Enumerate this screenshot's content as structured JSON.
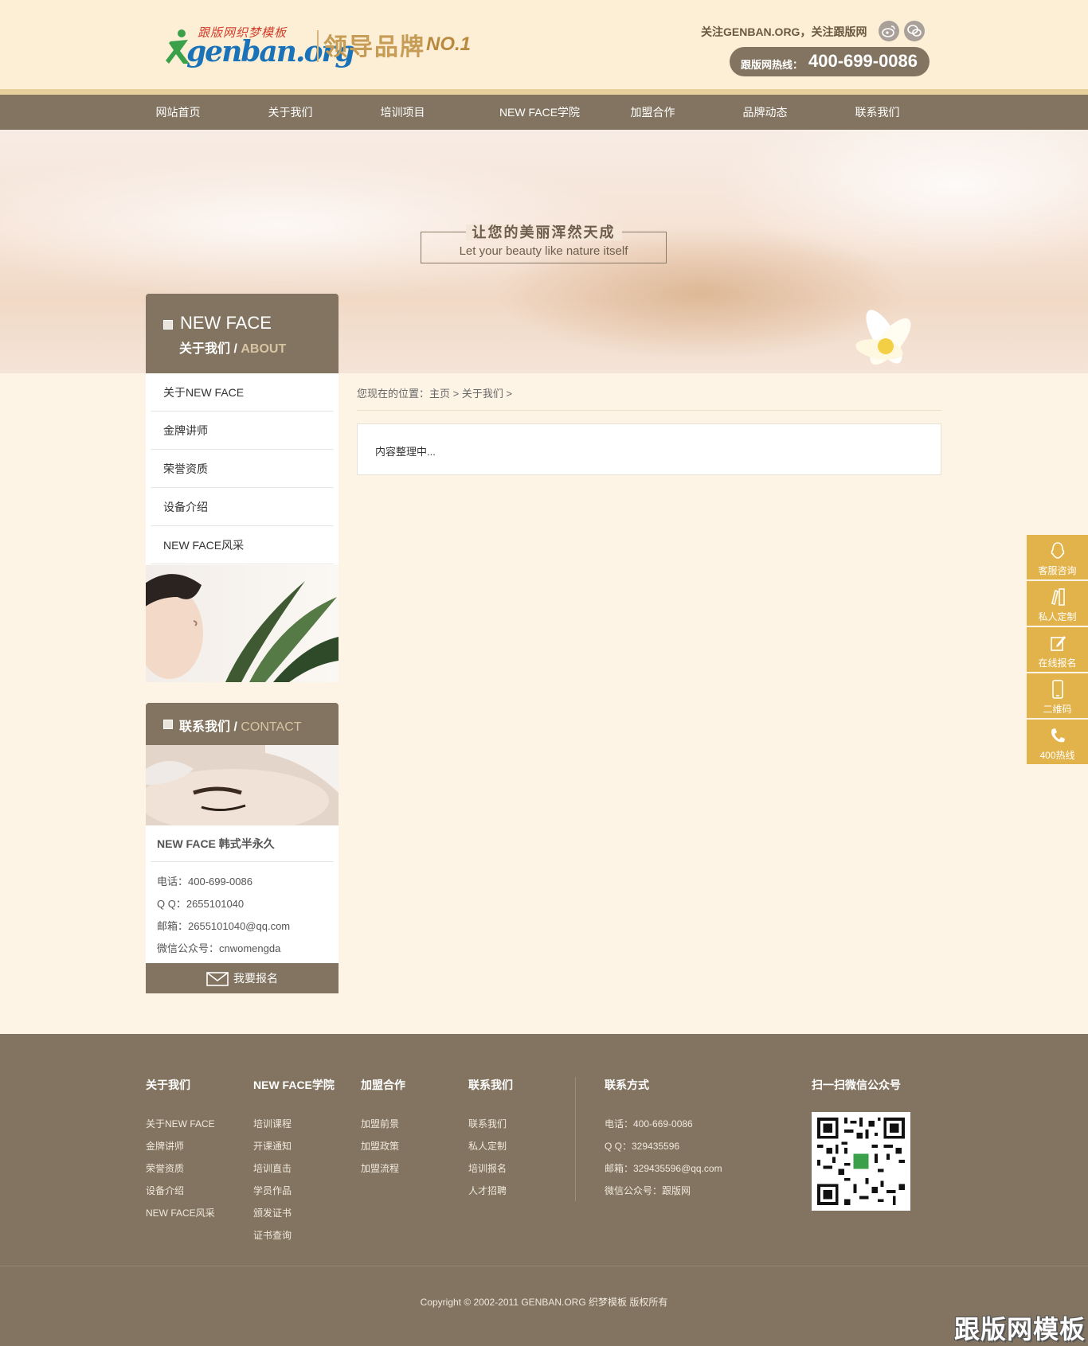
{
  "header": {
    "logo_top": "跟版网织梦模板",
    "logo_main": "genban.org",
    "slogan": "领导品牌",
    "slogan_badge": "NO.1",
    "follow_text": "关注GENBAN.ORG，关注跟版网",
    "social_icons": [
      "weibo-icon",
      "wechat-icon"
    ],
    "hotline_label": "跟版网热线：",
    "hotline_number": "400-699-0086"
  },
  "nav": {
    "items": [
      "网站首页",
      "关于我们",
      "培训项目",
      "NEW FACE学院",
      "加盟合作",
      "品牌动态",
      "联系我们"
    ]
  },
  "banner": {
    "title": "让您的美丽浑然天成",
    "subtitle": "Let your beauty like nature itself"
  },
  "sidebar": {
    "title": "NEW FACE",
    "subtitle_cn": "关于我们",
    "subtitle_sep": "/",
    "subtitle_en": "ABOUT",
    "items": [
      "关于NEW FACE",
      "金牌讲师",
      "荣誉资质",
      "设备介绍",
      "NEW FACE风采"
    ]
  },
  "contact": {
    "title_cn": "联系我们",
    "title_sep": "/",
    "title_en": "CONTACT",
    "name": "NEW FACE 韩式半永久",
    "phone": "电话：400-699-0086",
    "qq": "Q Q：2655101040",
    "email": "邮箱：2655101040@qq.com",
    "wechat": "微信公众号：cnwomengda",
    "signup_label": "我要报名"
  },
  "main": {
    "breadcrumb": "您现在的位置：主页 > 关于我们 >",
    "content": "内容整理中..."
  },
  "float_bar": {
    "items": [
      {
        "label": "客服咨询",
        "icon": "qq-icon"
      },
      {
        "label": "私人定制",
        "icon": "pencil-ruler-icon"
      },
      {
        "label": "在线报名",
        "icon": "edit-icon"
      },
      {
        "label": "二维码",
        "icon": "phone-icon"
      },
      {
        "label": "400热线",
        "icon": "call-icon"
      }
    ]
  },
  "footer": {
    "columns": [
      {
        "title": "关于我们",
        "links": [
          "关于NEW FACE",
          "金牌讲师",
          "荣誉资质",
          "设备介绍",
          "NEW FACE风采"
        ]
      },
      {
        "title": "NEW FACE学院",
        "links": [
          "培训课程",
          "开课通知",
          "培训直击",
          "学员作品",
          "颁发证书",
          "证书查询"
        ]
      },
      {
        "title": "加盟合作",
        "links": [
          "加盟前景",
          "加盟政策",
          "加盟流程"
        ]
      },
      {
        "title": "联系我们",
        "links": [
          "联系我们",
          "私人定制",
          "培训报名",
          "人才招聘"
        ]
      }
    ],
    "contact_title": "联系方式",
    "contact_lines": [
      "电话：400-669-0086",
      "Q Q：329435596",
      "邮箱：329435596@qq.com",
      "微信公众号：跟版网"
    ],
    "qr_title": "扫一扫微信公众号",
    "copyright": "Copyright © 2002-2011 GENBAN.ORG 织梦模板 版权所有"
  },
  "watermark": "跟版网模板",
  "colors": {
    "header_bg": "#fdefd5",
    "nav_bg": "#827460",
    "page_bg": "#fdf4e6",
    "accent_gold": "#e2b34a",
    "footer_bg": "#827460"
  }
}
